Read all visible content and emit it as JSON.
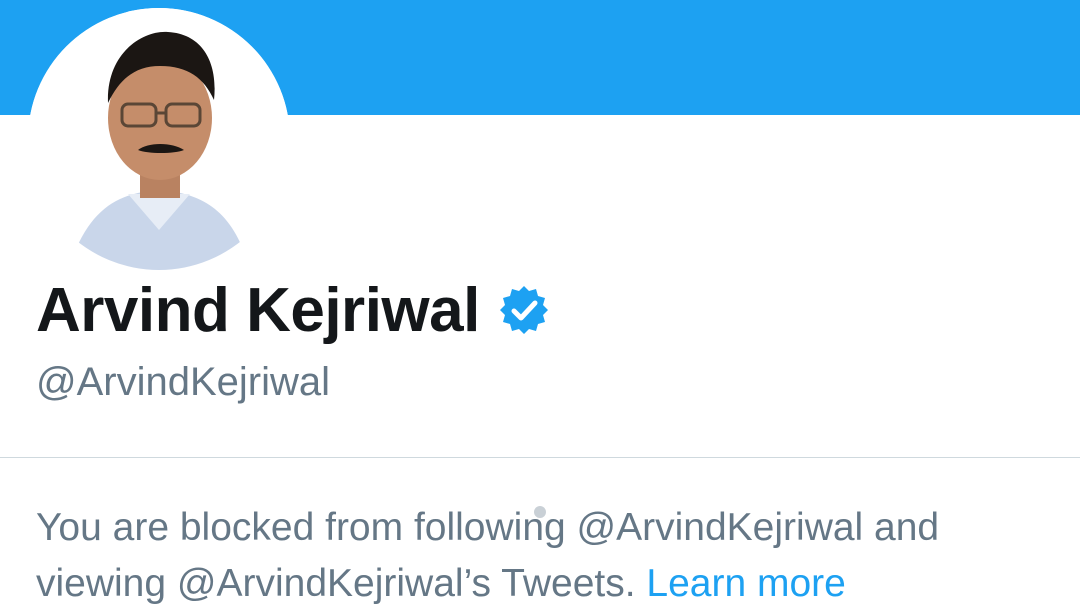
{
  "profile": {
    "display_name": "Arvind Kejriwal",
    "handle": "@ArvindKejriwal",
    "verified_icon": "verified-badge-icon",
    "avatar_icon": "profile-photo"
  },
  "notice": {
    "text": "You are blocked from following @ArvindKejriwal and viewing @ArvindKejriwal’s Tweets.",
    "link_label": "Learn more"
  },
  "colors": {
    "banner": "#1da1f2",
    "accent": "#1da1f2",
    "name_text": "#14171a",
    "muted_text": "#657786",
    "divider": "#cfd9de"
  }
}
